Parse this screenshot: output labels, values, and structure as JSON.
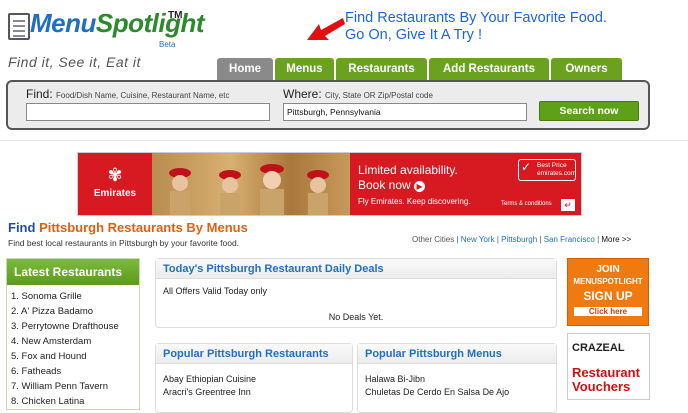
{
  "logo": {
    "part1": "Menu",
    "part2": "Spotlight",
    "tm": "TM",
    "beta": "Beta",
    "tagline": "Find it, See it, Eat it"
  },
  "promo": {
    "line1": "Find Restaurants By Your Favorite Food.",
    "line2": "Go On, Give It A Try !"
  },
  "nav": [
    "Home",
    "Menus",
    "Restaurants",
    "Add Restaurants",
    "Owners"
  ],
  "search": {
    "find_label": "Find:",
    "find_hint": "Food/Dish Name, Cuisine, Restaurant Name, etc",
    "find_value": "",
    "where_label": "Where:",
    "where_hint": "City, State OR Zip/Postal code",
    "where_value": "Pittsburgh, Pennsylvania",
    "button": "Search now"
  },
  "ad": {
    "brand": "Emirates",
    "headline1": "Limited availability.",
    "headline2": "Book now",
    "tagline": "Fly Emirates. Keep discovering.",
    "badge1": "Best Price",
    "badge2": "emirates.com",
    "terms": "Terms & conditions"
  },
  "heading": {
    "find": "Find",
    "highlight": "Pittsburgh Restaurants By Menus",
    "sub": "Find best local restaurants in Pittsburgh by your favorite food."
  },
  "other_cities": {
    "label": "Other Cities",
    "sep": "|",
    "cities": [
      "New York",
      "Pittsburgh",
      "San Francisco"
    ],
    "more": "More >>"
  },
  "latest": {
    "title": "Latest Restaurants",
    "items": [
      "1. Sonoma Grille",
      "2. A' Pizza Badamo",
      "3. Perrytowne Drafthouse",
      "4. New Amsterdam",
      "5. Fox and Hound",
      "6. Fatheads",
      "7. William Penn Tavern",
      "8. Chicken Latina"
    ]
  },
  "deals": {
    "title": "Today's Pittsburgh Restaurant Daily Deals",
    "note": "All Offers Valid Today only",
    "empty": "No Deals Yet."
  },
  "popular_restaurants": {
    "title": "Popular Pittsburgh Restaurants",
    "items": [
      "Abay Ethiopian Cuisine",
      "Aracri's Greentree Inn"
    ]
  },
  "popular_menus": {
    "title": "Popular Pittsburgh Menus",
    "items": [
      "Halawa Bi-Jibn",
      "Chuletas De Cerdo En Salsa De Ajo"
    ]
  },
  "join": {
    "line1": "JOIN",
    "line2": "MENUSPOTLIGHT",
    "line3": "SIGN UP",
    "line4": "Click here"
  },
  "crazeal": {
    "brand": "CRAZEAL",
    "text1": "Restaurant",
    "text2": "Vouchers"
  }
}
